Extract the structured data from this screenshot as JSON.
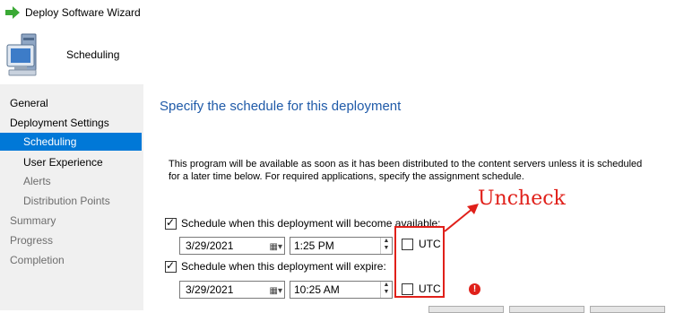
{
  "window": {
    "title": "Deploy Software Wizard"
  },
  "header": {
    "title": "Scheduling"
  },
  "nav": {
    "items": [
      {
        "label": "General"
      },
      {
        "label": "Deployment Settings"
      },
      {
        "label": "Scheduling"
      },
      {
        "label": "User Experience"
      },
      {
        "label": "Alerts"
      },
      {
        "label": "Distribution Points"
      },
      {
        "label": "Summary"
      },
      {
        "label": "Progress"
      },
      {
        "label": "Completion"
      }
    ]
  },
  "main": {
    "heading": "Specify the schedule for this deployment",
    "description": "This program will be available as soon as it has been distributed to the content servers unless it is scheduled for a later time below. For required applications, specify the assignment schedule.",
    "available": {
      "label": "Schedule when this deployment will become available:",
      "checked": true,
      "date": "3/29/2021",
      "time": "1:25 PM",
      "utc_label": "UTC",
      "utc_checked": false
    },
    "expire": {
      "label": "Schedule when this deployment will expire:",
      "checked": true,
      "date": "3/29/2021",
      "time": "10:25 AM",
      "utc_label": "UTC",
      "utc_checked": false
    }
  },
  "annotation": {
    "text": "Uncheck",
    "color": "#e0201a"
  },
  "colors": {
    "accent": "#0078d7",
    "heading": "#1f5aa8"
  }
}
